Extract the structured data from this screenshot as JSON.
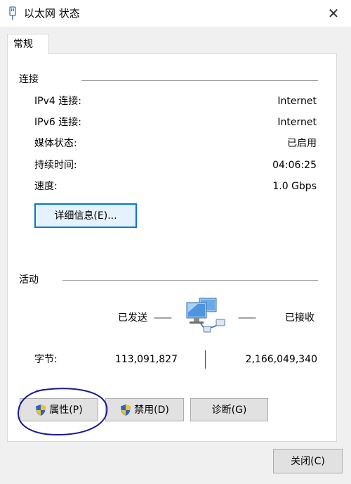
{
  "window": {
    "title": "以太网 状态",
    "close_glyph": "✕"
  },
  "tabs": [
    {
      "label": "常规"
    }
  ],
  "connection": {
    "group_label": "连接",
    "rows": [
      {
        "label": "IPv4 连接:",
        "value": "Internet"
      },
      {
        "label": "IPv6 连接:",
        "value": "Internet"
      },
      {
        "label": "媒体状态:",
        "value": "已启用"
      },
      {
        "label": "持续时间:",
        "value": "04:06:25"
      },
      {
        "label": "速度:",
        "value": "1.0 Gbps"
      }
    ],
    "details_button": "详细信息(E)..."
  },
  "activity": {
    "group_label": "活动",
    "sent_label": "已发送",
    "received_label": "已接收",
    "dash": "——",
    "bytes_label": "字节:",
    "bytes_sent": "113,091,827",
    "bytes_received": "2,166,049,340",
    "icon": "network-computers-icon"
  },
  "buttons": {
    "properties": "属性(P)",
    "disable": "禁用(D)",
    "diagnose": "诊断(G)",
    "close": "关闭(C)"
  },
  "colors": {
    "focus_border": "#0078d7",
    "annotation_ink": "#1a1a8c",
    "shield_blue": "#2a64c8",
    "shield_yellow": "#f2c12e"
  }
}
